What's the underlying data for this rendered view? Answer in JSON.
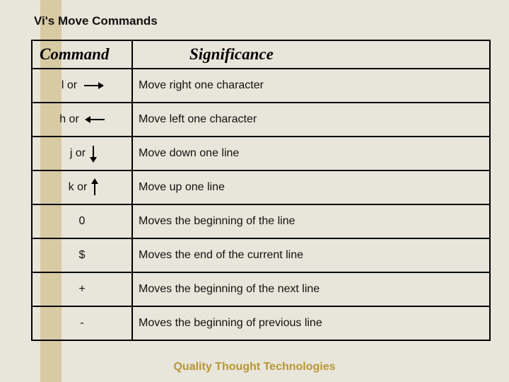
{
  "slide": {
    "title": "Vi's Move Commands",
    "footer": "Quality Thought Technologies"
  },
  "chart_data": {
    "type": "table",
    "title": "Vi's Move Commands",
    "columns": [
      "Command",
      "Significance"
    ],
    "rows": [
      {
        "command": "l or",
        "arrow": "right",
        "significance": "Move right one character"
      },
      {
        "command": "h or",
        "arrow": "left",
        "significance": "Move left one character"
      },
      {
        "command": "j or",
        "arrow": "down",
        "significance": "Move down one line"
      },
      {
        "command": "k or",
        "arrow": "up",
        "significance": "Move up one line"
      },
      {
        "command": "0",
        "arrow": null,
        "significance": "Moves the beginning of the line"
      },
      {
        "command": "$",
        "arrow": null,
        "significance": "Moves the end of the current line"
      },
      {
        "command": "+",
        "arrow": null,
        "significance": "Moves the beginning of the next line"
      },
      {
        "command": "-",
        "arrow": null,
        "significance": "Moves the beginning of previous line"
      }
    ]
  }
}
